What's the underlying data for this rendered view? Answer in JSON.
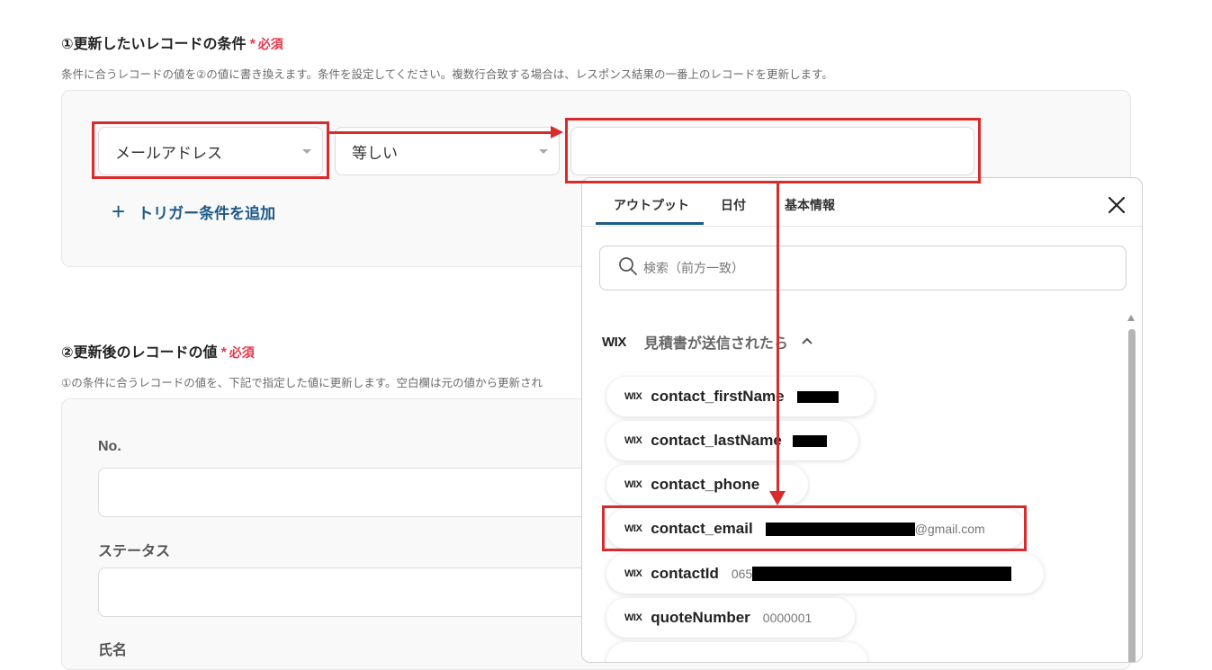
{
  "section1": {
    "title": "①更新したいレコードの条件",
    "required_mark": "*",
    "required_text": "必須",
    "description": "条件に合うレコードの値を②の値に書き換えます。条件を設定してください。複数行合致する場合は、レスポンス結果の一番上のレコードを更新します。",
    "field_select": "メールアドレス",
    "operator_select": "等しい",
    "value_input": "",
    "add_condition": "トリガー条件を追加"
  },
  "section2": {
    "title": "②更新後のレコードの値",
    "required_mark": "*",
    "required_text": "必須",
    "description": "①の条件に合うレコードの値を、下記で指定した値に更新します。空白欄は元の値から更新され",
    "fields": [
      {
        "label": "No.",
        "value": ""
      },
      {
        "label": "ステータス",
        "value": ""
      },
      {
        "label": "氏名"
      }
    ]
  },
  "popup": {
    "tabs": [
      "アウトプット",
      "日付",
      "基本情報"
    ],
    "active_tab": 0,
    "search_placeholder": "検索（前方一致）",
    "group_logo": "WIX",
    "group_title": "見積書が送信されたら",
    "items": [
      {
        "logo": "WIX",
        "name": "contact_firstName",
        "value": ""
      },
      {
        "logo": "WIX",
        "name": "contact_lastName",
        "value": ""
      },
      {
        "logo": "WIX",
        "name": "contact_phone",
        "value": ""
      },
      {
        "logo": "WIX",
        "name": "contact_email",
        "value": "@gmail.com"
      },
      {
        "logo": "WIX",
        "name": "contactId",
        "value": "065"
      },
      {
        "logo": "WIX",
        "name": "quoteNumber",
        "value": "0000001"
      }
    ]
  },
  "colors": {
    "accent": "#1e5a86",
    "required": "#e5384b",
    "highlight": "#d92b2b"
  }
}
